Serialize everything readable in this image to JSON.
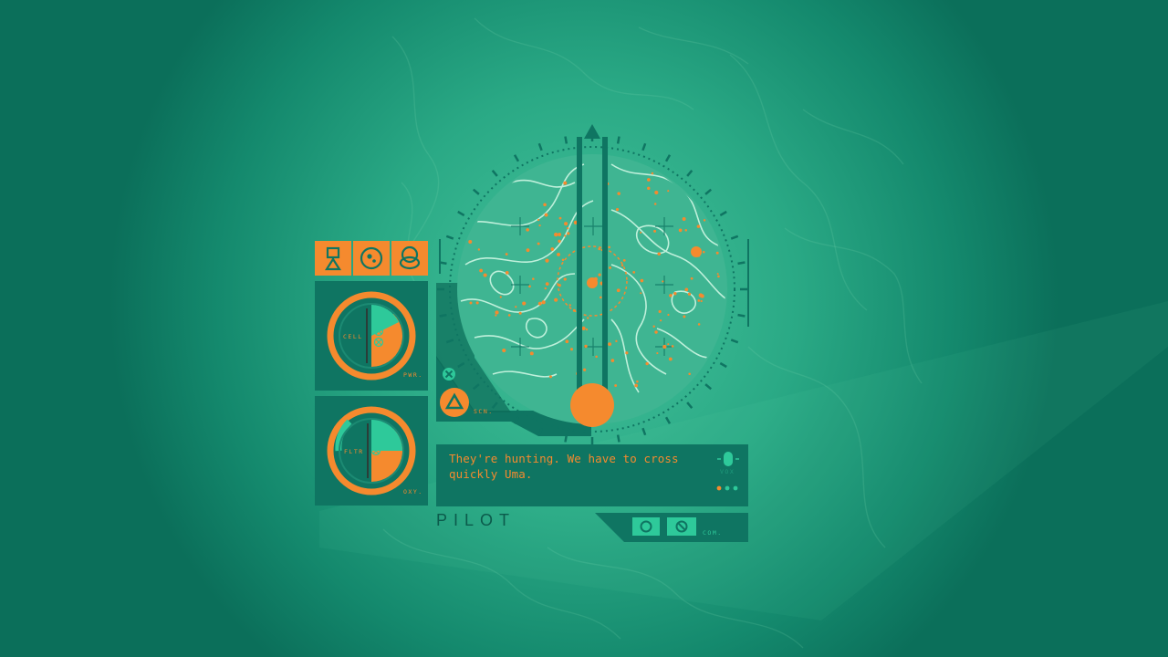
{
  "hud": {
    "gauges": {
      "power": {
        "inner_label": "CELL",
        "corner_label": "PWR.",
        "level": 0.5
      },
      "oxygen": {
        "inner_label": "FLTR",
        "corner_label": "OXY.",
        "level": 0.5
      }
    },
    "top_icons": [
      "beacon-icon",
      "cell-icon",
      "diver-icon"
    ],
    "scan": {
      "label": "SCN.",
      "button_icons": [
        "x-button-icon",
        "triangle-button-icon"
      ]
    },
    "dialog": {
      "text": "They're hunting. We have to cross quickly Uma.",
      "speaker_label": "VOX"
    },
    "pilot_label": "PILOT",
    "comms": {
      "label": "COM.",
      "button_icons": [
        "circle-button-icon",
        "cancel-button-icon"
      ]
    }
  },
  "colors": {
    "accent": "#f58a2e",
    "panel": "#0f7562",
    "highlight": "#2ec99a",
    "background": "#2aa985"
  }
}
